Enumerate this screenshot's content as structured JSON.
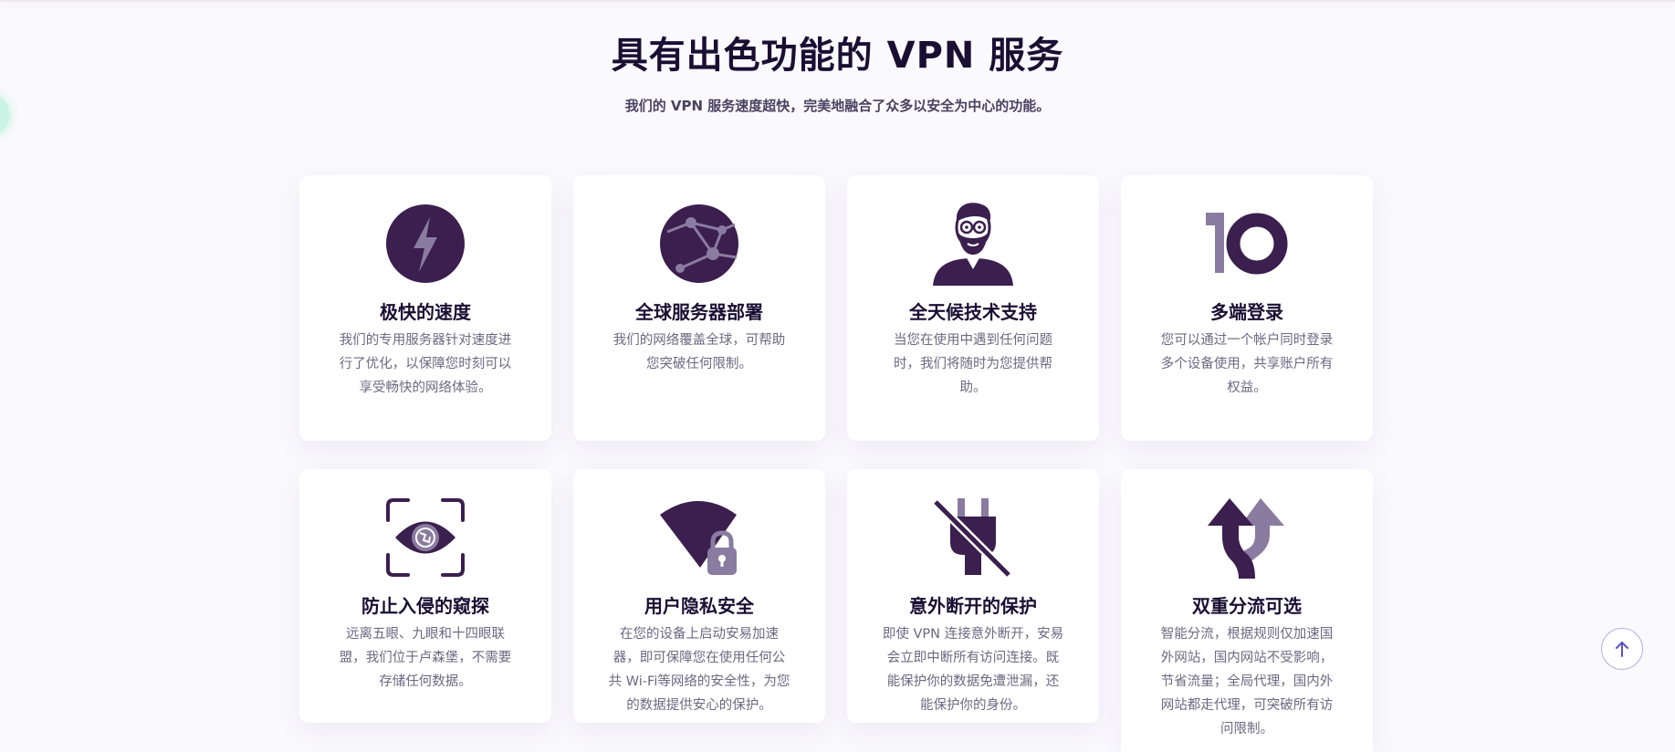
{
  "header": {
    "title": "具有出色功能的 VPN 服务",
    "subtitle": "我们的 VPN 服务速度超快，完美地融合了众多以安全为中心的功能。"
  },
  "colors": {
    "primary": "#3b1f4e",
    "secondary": "#8a7ca0",
    "title": "#1a0f33",
    "text": "#6d6880"
  },
  "features": [
    {
      "icon": "lightning-icon",
      "title": "极快的速度",
      "desc": "我们的专用服务器针对速度进行了优化，以保障您时刻可以享受畅快的网络体验。"
    },
    {
      "icon": "globe-network-icon",
      "title": "全球服务器部署",
      "desc": "我们的网络覆盖全球，可帮助您突破任何限制。"
    },
    {
      "icon": "support-person-icon",
      "title": "全天候技术支持",
      "desc": "当您在使用中遇到任何问题时，我们将随时为您提供帮助。"
    },
    {
      "icon": "ten-devices-icon",
      "title": "多端登录",
      "desc": "您可以通过一个帐户同时登录多个设备使用，共享账户所有权益。"
    },
    {
      "icon": "eye-scan-icon",
      "title": "防止入侵的窥探",
      "desc": "远离五眼、九眼和十四眼联盟，我们位于卢森堡，不需要存储任何数据。"
    },
    {
      "icon": "wifi-lock-icon",
      "title": "用户隐私安全",
      "desc": "在您的设备上启动安易加速器，即可保障您在使用任何公共 Wi-Fi等网络的安全性，为您的数据提供安心的保护。"
    },
    {
      "icon": "unplug-icon",
      "title": "意外断开的保护",
      "desc": "即使 VPN 连接意外断开，安易会立即中断所有访问连接。既能保护你的数据免遭泄漏，还能保护你的身份。"
    },
    {
      "icon": "split-arrows-icon",
      "title": "双重分流可选",
      "desc": "智能分流，根据规则仅加速国外网站，国内网站不受影响，节省流量；全局代理，国内外网站都走代理，可突破所有访问限制。"
    }
  ],
  "scroll_top": {
    "icon": "arrow-up-icon"
  }
}
